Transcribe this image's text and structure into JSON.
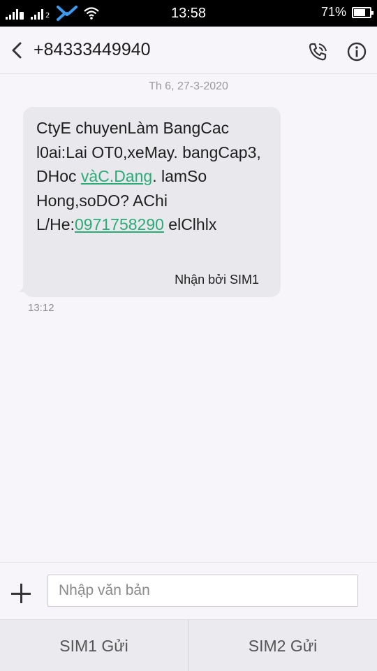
{
  "status_bar": {
    "sim2_label": "2",
    "time": "13:58",
    "battery_percent_text": "71%",
    "battery_level": 0.71
  },
  "header": {
    "contact": "+84333449940"
  },
  "conversation": {
    "date": "Th 6, 27-3-2020",
    "message": {
      "segments": [
        {
          "text": "CtyE chuyenLàm BangCac l0ai:Lai OT0,xeMay. bangCap3, DHoc ",
          "link": false
        },
        {
          "text": "vàC.Dang",
          "link": true
        },
        {
          "text": ". lamSo Hong,soDO? AChi L/He:",
          "link": false
        },
        {
          "text": "0971758290",
          "link": true
        },
        {
          "text": " elClhlx",
          "link": false
        }
      ],
      "received_by": "Nhận bởi SIM1",
      "time": "13:12"
    }
  },
  "compose": {
    "placeholder": "Nhập văn bản"
  },
  "send_bar": {
    "sim1_label": "SIM1 Gửi",
    "sim2_label": "SIM2 Gửi"
  },
  "colors": {
    "link": "#2bab77",
    "bubble": "#e9e8ec",
    "background": "#f7f5f9"
  }
}
